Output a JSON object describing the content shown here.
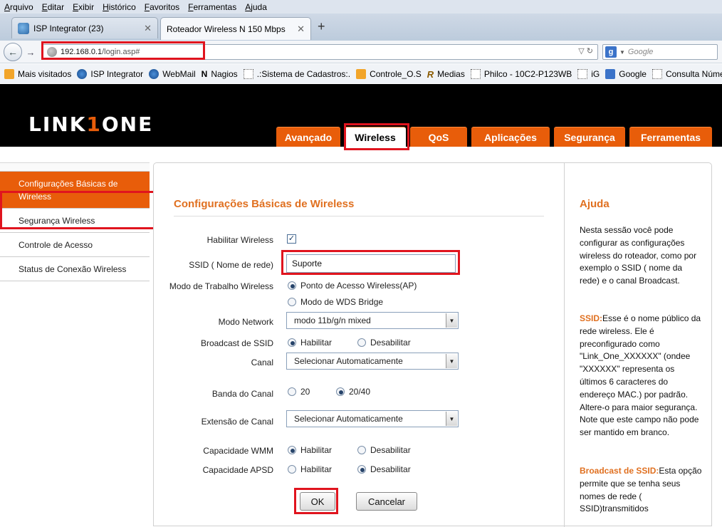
{
  "browser": {
    "menu": [
      "Arquivo",
      "Editar",
      "Exibir",
      "Histórico",
      "Favoritos",
      "Ferramentas",
      "Ajuda"
    ],
    "tabs": [
      {
        "title": "ISP Integrator (23)"
      },
      {
        "title": "Roteador Wireless N 150 Mbps"
      }
    ],
    "url_host": "192.168.0.1",
    "url_path": "/login.asp#",
    "search_placeholder": "Google",
    "bookmarks": [
      {
        "label": "Mais visitados",
        "icon": "folder-icon"
      },
      {
        "label": "ISP Integrator",
        "icon": "isp-icon"
      },
      {
        "label": "WebMail",
        "icon": "webmail-icon"
      },
      {
        "label": "Nagios",
        "icon": "nagios-icon"
      },
      {
        "label": ".:Sistema de Cadastros:.",
        "icon": "page-icon"
      },
      {
        "label": "Controle_O.S",
        "icon": "calendar-icon"
      },
      {
        "label": "Medias",
        "icon": "r-icon"
      },
      {
        "label": "Philco - 10C2-P123WB",
        "icon": "page-icon"
      },
      {
        "label": "iG",
        "icon": "page-icon"
      },
      {
        "label": "Google",
        "icon": "google-icon"
      },
      {
        "label": "Consulta Núme",
        "icon": "page-icon"
      }
    ]
  },
  "router": {
    "logo_left": "LINK",
    "logo_mark": "1",
    "logo_right": "ONE",
    "nav": [
      "Avançado",
      "Wireless",
      "QoS",
      "Aplicações",
      "Segurança",
      "Ferramentas"
    ],
    "sidebar": [
      "Configurações Básicas de Wireless",
      "Segurança Wireless",
      "Controle de Acesso",
      "Status de Conexão Wireless"
    ],
    "title": "Configurações Básicas de Wireless",
    "form": {
      "enable_label": "Habilitar Wireless",
      "enable_checked": true,
      "ssid_label": "SSID ( Nome de rede)",
      "ssid_value": "Suporte",
      "mode_label": "Modo de Trabalho Wireless",
      "mode_opt1": "Ponto de Acesso Wireless(AP)",
      "mode_opt2": "Modo de WDS Bridge",
      "network_label": "Modo Network",
      "network_value": "modo 11b/g/n mixed",
      "broadcast_label": "Broadcast de SSID",
      "enable_opt": "Habilitar",
      "disable_opt": "Desabilitar",
      "channel_label": "Canal",
      "channel_value": "Selecionar Automaticamente",
      "bandwidth_label": "Banda do Canal",
      "bw_20": "20",
      "bw_2040": "20/40",
      "ext_label": "Extensão de Canal",
      "ext_value": "Selecionar Automaticamente",
      "wmm_label": "Capacidade WMM",
      "apsd_label": "Capacidade APSD",
      "ok": "OK",
      "cancel": "Cancelar"
    },
    "help": {
      "title": "Ajuda",
      "p1": "Nesta sessão você pode configurar as configurações wireless do roteador, como por exemplo o SSID ( nome da rede) e o canal Broadcast.",
      "ssid_term": "SSID:",
      "p2": "Esse é o nome público da rede wireless. Ele é preconfigurado como \"Link_One_XXXXXX\" (ondee \"XXXXXX\" representa os últimos 6 caracteres do endereço MAC.) por padrão. Altere-o para maior segurança. Note que este campo não pode ser mantido em branco.",
      "broadcast_term": "Broadcast de SSID:",
      "p3": "Esta opção permite que se tenha seus nomes de rede ( SSID)transmitidos"
    }
  },
  "colors": {
    "accent": "#e85d0a",
    "annotation": "#e0141e"
  }
}
